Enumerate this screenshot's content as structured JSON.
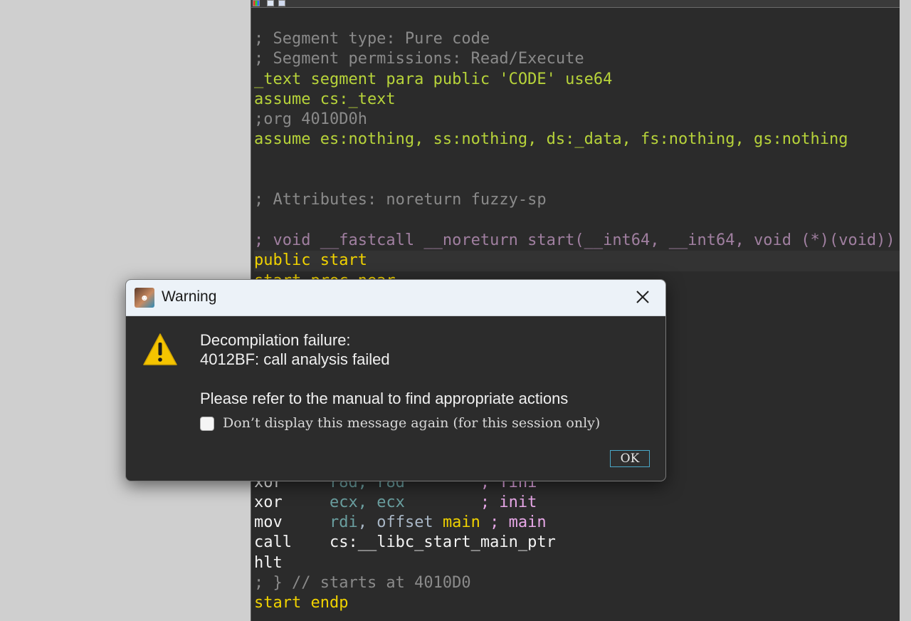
{
  "code_lines": [
    {
      "parts": [
        {
          "t": "; Segment type: Pure code",
          "c": "c-comment"
        }
      ]
    },
    {
      "parts": [
        {
          "t": "; Segment permissions: Read/Execute",
          "c": "c-comment"
        }
      ]
    },
    {
      "parts": [
        {
          "t": "_text segment para public 'CODE' use64",
          "c": "c-kw"
        }
      ]
    },
    {
      "parts": [
        {
          "t": "assume cs:_text",
          "c": "c-kw"
        }
      ]
    },
    {
      "parts": [
        {
          "t": ";org 4010D0h",
          "c": "c-comment"
        }
      ]
    },
    {
      "parts": [
        {
          "t": "assume es:nothing, ss:nothing, ds:_data, fs:nothing, gs:nothing",
          "c": "c-kw"
        }
      ]
    },
    {
      "parts": []
    },
    {
      "parts": []
    },
    {
      "parts": [
        {
          "t": "; Attributes: noreturn fuzzy-sp",
          "c": "c-comment"
        }
      ]
    },
    {
      "parts": []
    },
    {
      "parts": [
        {
          "t": "; void __fastcall __noreturn start(__int64, __int64, void (*)(void))",
          "c": "c-purple"
        }
      ]
    },
    {
      "hl": true,
      "parts": [
        {
          "t": "public ",
          "c": "c-ident"
        },
        {
          "t": "start",
          "c": "c-ident"
        }
      ]
    },
    {
      "parts": [
        {
          "t": "start proc near",
          "c": "c-ident"
        }
      ]
    },
    {
      "parts": []
    },
    {
      "parts": []
    },
    {
      "parts": []
    },
    {
      "parts": []
    },
    {
      "parts": []
    },
    {
      "parts": []
    },
    {
      "parts": []
    },
    {
      "parts": []
    },
    {
      "parts": []
    },
    {
      "parts": [
        {
          "t": "xor     ",
          "c": "c-mnem"
        },
        {
          "t": "r8d, r8d",
          "c": "c-reg"
        },
        {
          "t": "        ; fini",
          "c": "c-pink"
        }
      ]
    },
    {
      "parts": [
        {
          "t": "xor     ",
          "c": "c-mnem"
        },
        {
          "t": "ecx, ecx",
          "c": "c-reg"
        },
        {
          "t": "        ; init",
          "c": "c-pink"
        }
      ]
    },
    {
      "parts": [
        {
          "t": "mov     ",
          "c": "c-mnem"
        },
        {
          "t": "rdi",
          "c": "c-reg"
        },
        {
          "t": ", offset ",
          "c": "c-offset"
        },
        {
          "t": "main",
          "c": "c-ident"
        },
        {
          "t": " ; main",
          "c": "c-pink"
        }
      ]
    },
    {
      "parts": [
        {
          "t": "call    ",
          "c": "c-mnem"
        },
        {
          "t": "cs:__libc_start_main_ptr",
          "c": "c-mnem"
        }
      ]
    },
    {
      "parts": [
        {
          "t": "hlt",
          "c": "c-mnem"
        }
      ]
    },
    {
      "parts": [
        {
          "t": "; } // starts at 4010D0",
          "c": "c-comment"
        }
      ]
    },
    {
      "parts": [
        {
          "t": "start endp",
          "c": "c-ident"
        }
      ]
    }
  ],
  "dialog": {
    "title": "Warning",
    "message_line1": "Decompilation failure:",
    "message_line2": "4012BF: call analysis failed",
    "message_line3": "Please refer to the manual to find appropriate actions",
    "checkbox_label": "Don’t display this message again (for this session only)",
    "checkbox_checked": false,
    "ok_label": "OK",
    "icons": {
      "app": "ida-app-icon",
      "warning": "warning-icon",
      "close": "close-icon"
    }
  },
  "colors": {
    "background": "#2b2b2b",
    "comment": "#8a8a8a",
    "keyword": "#b7d33a",
    "identifier": "#f0d200",
    "warning": "#f5c400"
  }
}
